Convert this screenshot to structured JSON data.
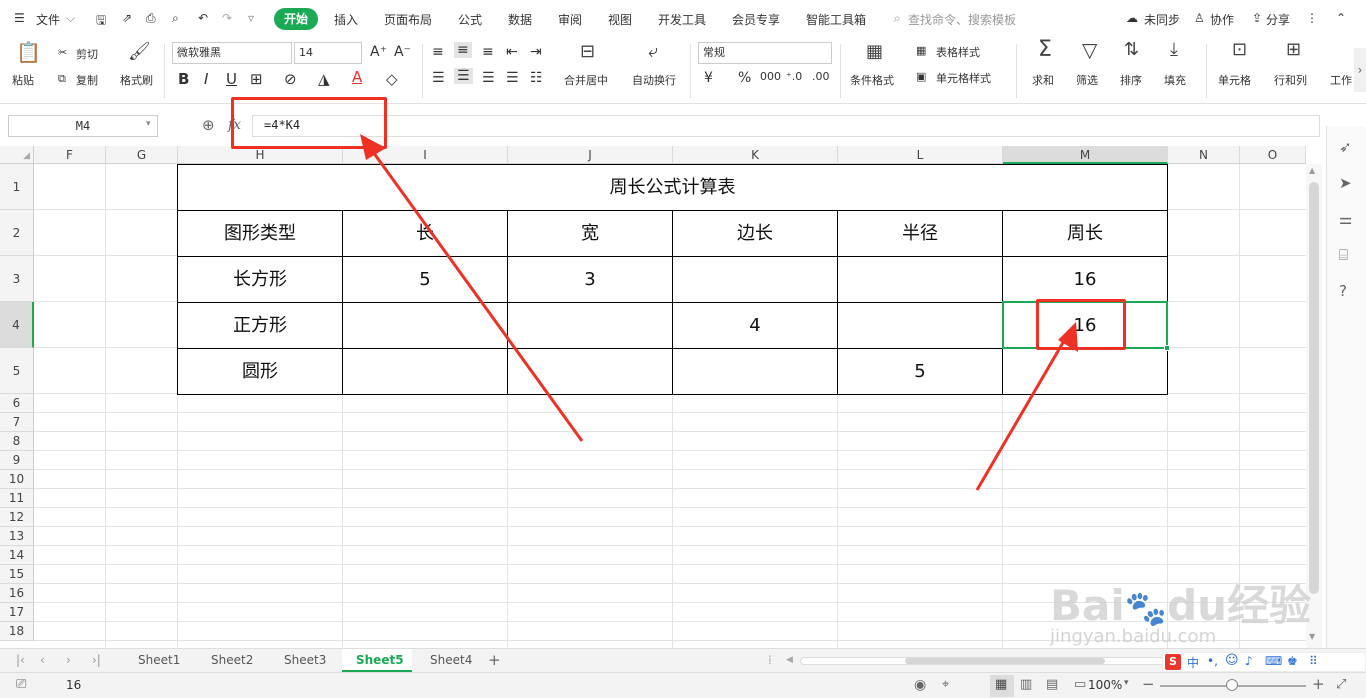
{
  "menu": {
    "file": "文件",
    "tabs": [
      "开始",
      "插入",
      "页面布局",
      "公式",
      "数据",
      "审阅",
      "视图",
      "开发工具",
      "会员专享",
      "智能工具箱"
    ],
    "search_placeholder": "查找命令、搜索模板",
    "unsync": "未同步",
    "collab": "协作",
    "share": "分享"
  },
  "ribbon": {
    "paste": "粘贴",
    "cut": "剪切",
    "copy": "复制",
    "format_painter": "格式刷",
    "font_name": "微软雅黑",
    "font_size": "14",
    "merge_center": "合并居中",
    "wrap": "自动换行",
    "number_format": "常规",
    "currency": "¥",
    "percent": "%",
    "thousands": "000",
    "cond_format": "条件格式",
    "table_style": "表格样式",
    "cell_style": "单元格样式",
    "sum": "求和",
    "filter": "筛选",
    "sort": "排序",
    "fill": "填充",
    "cell": "单元格",
    "row_col": "行和列",
    "worksheet": "工作"
  },
  "formula_bar": {
    "name_box": "M4",
    "fx": "fx",
    "formula": "=4*K4"
  },
  "columns": [
    "F",
    "G",
    "H",
    "I",
    "J",
    "K",
    "L",
    "M",
    "N",
    "O"
  ],
  "rows": [
    "1",
    "2",
    "3",
    "4",
    "5",
    "6",
    "7",
    "8",
    "9",
    "10",
    "11",
    "12",
    "13",
    "14",
    "15",
    "16",
    "17",
    "18"
  ],
  "table": {
    "title": "周长公式计算表",
    "headers": [
      "图形类型",
      "长",
      "宽",
      "边长",
      "半径",
      "周长"
    ],
    "rows": [
      [
        "长方形",
        "5",
        "3",
        "",
        "",
        "16"
      ],
      [
        "正方形",
        "",
        "",
        "4",
        "",
        "16"
      ],
      [
        "圆形",
        "",
        "",
        "",
        "5",
        ""
      ]
    ]
  },
  "sheets": {
    "tabs": [
      "Sheet1",
      "Sheet2",
      "Sheet3",
      "Sheet5",
      "Sheet4"
    ],
    "active": "Sheet5"
  },
  "status": {
    "value": "16",
    "zoom": "100%"
  },
  "colors": {
    "accent": "#1aaa55",
    "annotation": "#ee3124"
  },
  "watermark": "Baidu经验 jingyan.baidu.com"
}
